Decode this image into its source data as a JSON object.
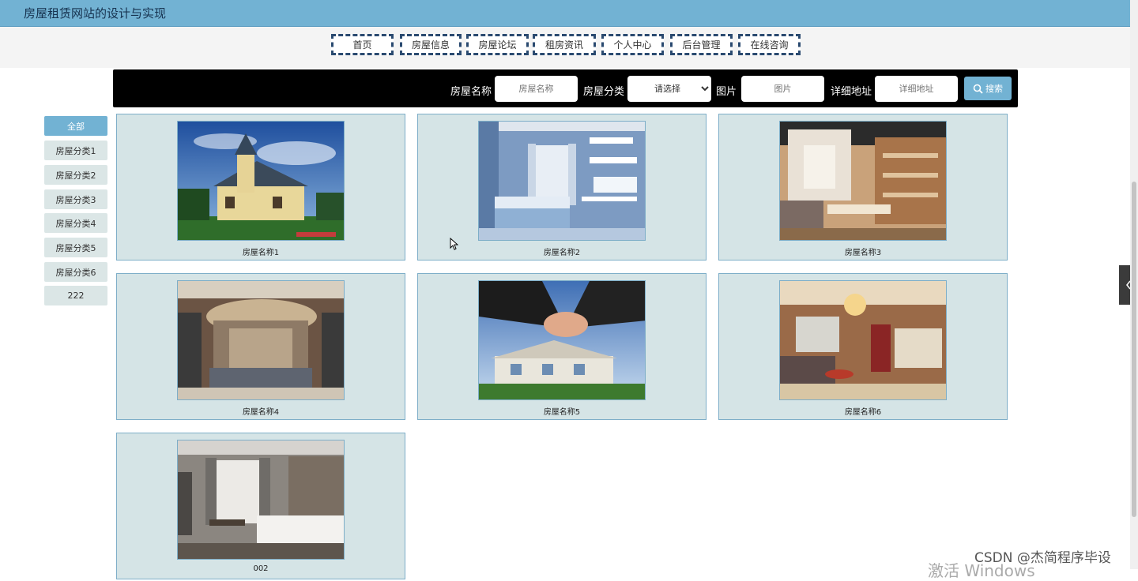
{
  "site": {
    "title": "房屋租赁网站的设计与实现"
  },
  "nav": [
    "首页",
    "房屋信息",
    "房屋论坛",
    "租房资讯",
    "个人中心",
    "后台管理",
    "在线咨询"
  ],
  "search": {
    "name_label": "房屋名称",
    "name_placeholder": "房屋名称",
    "category_label": "房屋分类",
    "category_value": "请选择",
    "image_label": "图片",
    "image_placeholder": "图片",
    "address_label": "详细地址",
    "address_placeholder": "详细地址",
    "button_label": "搜索",
    "button_icon": "search-icon"
  },
  "categories": [
    "全部",
    "房屋分类1",
    "房屋分类2",
    "房屋分类3",
    "房屋分类4",
    "房屋分类5",
    "房屋分类6",
    "222"
  ],
  "listings": [
    {
      "name": "房屋名称1",
      "image": "victorian-house-photo"
    },
    {
      "name": "房屋名称2",
      "image": "blue-bedroom-photo"
    },
    {
      "name": "房屋名称3",
      "image": "loft-dining-photo"
    },
    {
      "name": "房屋名称4",
      "image": "living-room-photo"
    },
    {
      "name": "房屋名称5",
      "image": "handshake-house-photo"
    },
    {
      "name": "房屋名称6",
      "image": "hotel-suite-photo"
    },
    {
      "name": "002",
      "image": "modern-bedroom-photo"
    }
  ],
  "watermarks": {
    "csdn": "CSDN @杰简程序毕设",
    "windows": "激活 Windows"
  },
  "colors": {
    "accent": "#72b2d3",
    "card_bg": "#d5e4e6",
    "nav_border": "#2a4a70"
  }
}
